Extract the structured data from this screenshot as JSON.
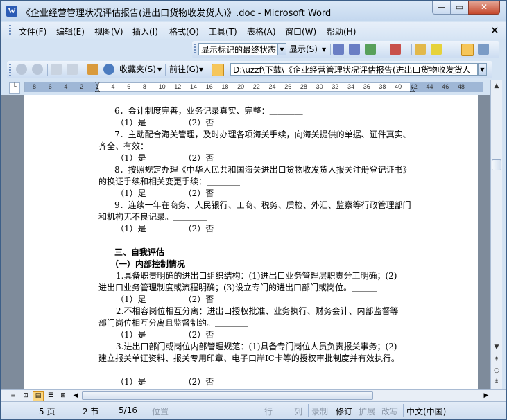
{
  "window": {
    "title": "《企业经营管理状况评估报告(进出口货物收发货人)》.doc - Microsoft Word",
    "app_icon_letter": "W"
  },
  "menu": [
    "文件(F)",
    "编辑(E)",
    "视图(V)",
    "插入(I)",
    "格式(O)",
    "工具(T)",
    "表格(A)",
    "窗口(W)",
    "帮助(H)"
  ],
  "review_toolbar": {
    "markup_state": "显示标记的最终状态",
    "show_label": "显示(S)"
  },
  "web_toolbar": {
    "favorites": "收藏夹(S)",
    "go": "前往(G)",
    "address": "D:\\uzzf\\下载\\《企业经营管理状况评估报告(进出口货物收发货人"
  },
  "ruler": {
    "labels": [
      "8",
      "6",
      "4",
      "2",
      "2",
      "4",
      "6",
      "8",
      "10",
      "12",
      "14",
      "16",
      "18",
      "20",
      "22",
      "24",
      "26",
      "28",
      "30",
      "32",
      "34",
      "36",
      "38",
      "40",
      "42",
      "44",
      "46",
      "48"
    ]
  },
  "document": {
    "lines": [
      "6．会计制度完善，业务记录真实、完整：＿＿＿＿",
      "（1）是　　　　　（2）否",
      "7．主动配合海关管理，及时办理各项海关手续，向海关提供的单据、证件真实、",
      "齐全、有效：＿＿＿＿",
      "（1）是　　　　　（2）否",
      "8．按照规定办理《中华人民共和国海关进出口货物收发货人报关注册登记证书》",
      "的换证手续和相关变更手续：＿＿＿＿",
      "（1）是　　　　　（2）否",
      "9．连续一年在商务、人民银行、工商、税务、质检、外汇、监察等行政管理部门",
      "和机构无不良记录。＿＿＿＿",
      "（1）是　　　　　（2）否",
      "三、自我评估",
      "（一）内部控制情况",
      "1.具备职责明确的进出口组织结构：(1)进出口业务管理层职责分工明确；(2)",
      "进出口业务管理制度或流程明确；(3)设立专门的进出口部门或岗位。＿＿＿",
      "（1）是　　　　　（2）否",
      "2.不相容岗位相互分离：进出口授权批准、业务执行、财务会计、内部监督等",
      "部门岗位相互分离且监督制约。＿＿＿＿",
      "（1）是　　　　　（2）否",
      "3.进出口部门或岗位内部管理规范：(1)具备专门岗位人员负责报关事务；(2)",
      "建立报关单证资料、报关专用印章、电子口岸IC卡等的授权审批制度并有效执行。",
      "＿＿＿＿",
      "（1）是　　　　　（2）否"
    ]
  },
  "status_bar": {
    "page": "5 页",
    "section": "2 节",
    "pages": "5/16",
    "position": "位置",
    "line": "行",
    "column": "列",
    "record": "录制",
    "track": "修订",
    "extend": "扩展",
    "overtype": "改写",
    "language": "中文(中国)"
  }
}
